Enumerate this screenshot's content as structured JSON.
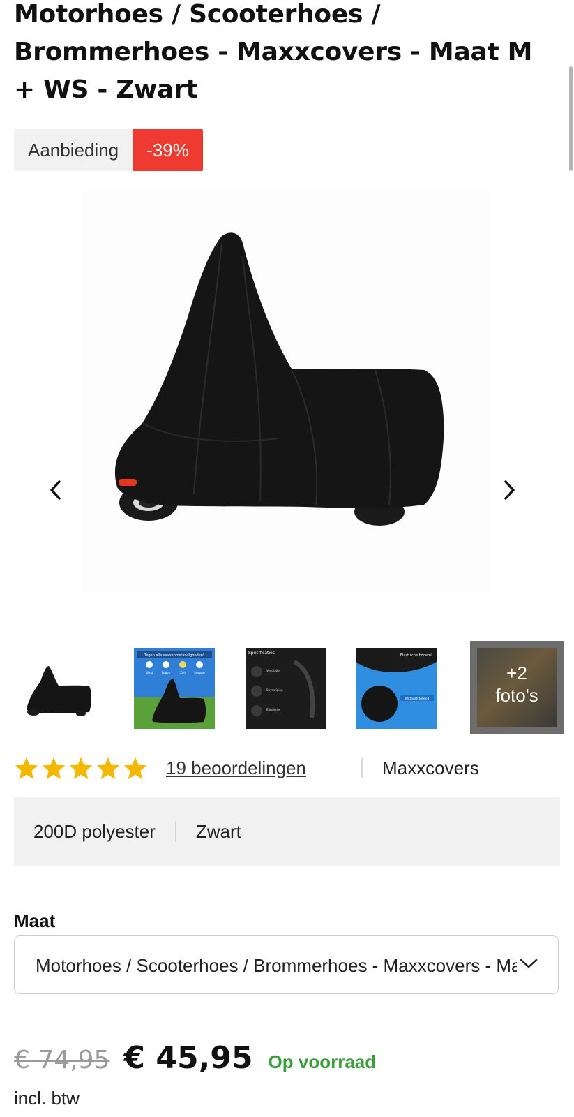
{
  "product": {
    "title": "Motorhoes / Scooterhoes / Brommerhoes - Maxxcovers - Maat M + WS - Zwart",
    "badge_sale": "Aanbieding",
    "badge_discount": "-39%"
  },
  "gallery": {
    "thumbs_more_count": "+2",
    "thumbs_more_label": "foto's",
    "thumb2_heading": "Tegen alle weersomstandigheden!",
    "thumb2_labels": [
      "Wind",
      "Regen",
      "Zon",
      "Sneeuw"
    ],
    "thumb3_heading": "Specificaties",
    "thumb3_labels": [
      "Ventilatie",
      "Bevestiging",
      "Elastische"
    ],
    "thumb4_heading": "Elastische bodem!",
    "thumb4_label": "Waterafstotend"
  },
  "rating": {
    "stars": 5,
    "reviews_label": "19 beoordelingen",
    "star_color": "#f5b800"
  },
  "brand": "Maxxcovers",
  "specs": [
    "200D polyester",
    "Zwart"
  ],
  "size": {
    "label": "Maat",
    "selected": "Motorhoes / Scooterhoes / Brommerhoes - Maxxcovers - Maat M + WS - Zwart"
  },
  "price": {
    "old": "€ 74,95",
    "new": "€ 45,95",
    "stock": "Op voorraad",
    "vat": "incl. btw"
  },
  "colors": {
    "discount": "#ef3a32",
    "stock": "#3a9e3a"
  }
}
